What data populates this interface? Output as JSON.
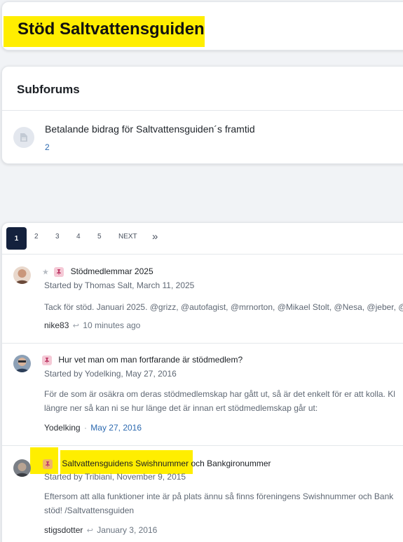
{
  "page_title": "Stöd Saltvattensguiden",
  "subforums": {
    "heading": "Subforums",
    "items": [
      {
        "title": "Betalande bidrag för Saltvattensguiden´s framtid",
        "count": "2"
      }
    ]
  },
  "pager": {
    "pages": [
      "1",
      "2",
      "3",
      "4",
      "5"
    ],
    "active": "1",
    "next_label": "NEXT",
    "last_label": "»"
  },
  "threads": [
    {
      "title": "Stödmedlemmar 2025",
      "meta": "Started by Thomas Salt, March 11, 2025",
      "snippet": "Tack för stöd. Januari 2025. @grizz, @autofagist, @mrnorton, @Mikael Stolt, @Nesa, @jeber, @",
      "last_user": "nike83",
      "last_time": "10 minutes ago",
      "starred": true
    },
    {
      "title": "Hur vet man om man fortfarande är stödmedlem?",
      "meta": "Started by Yodelking, May 27, 2016",
      "snippet": "För de som är osäkra om deras stödmedlemskap har gått ut, så är det enkelt för er att kolla. Kl",
      "snippet2": "längre ner så kan ni se hur länge det är innan ert stödmedlemskap går ut:",
      "last_user": "Yodelking",
      "last_sep": "·",
      "last_time": "May 27, 2016"
    },
    {
      "title_highlight": "Saltvattensguidens Swishnummer",
      "title_rest": " och Bankgironummer",
      "meta": "Started by Tribiani, November 9, 2015",
      "snippet": "Eftersom att alla funktioner inte är på plats ännu så finns föreningens Swishnummer och Bank",
      "snippet2": "stöd! /Saltvattensguiden",
      "last_user": "stigsdotter",
      "last_time": "January 3, 2016"
    }
  ]
}
